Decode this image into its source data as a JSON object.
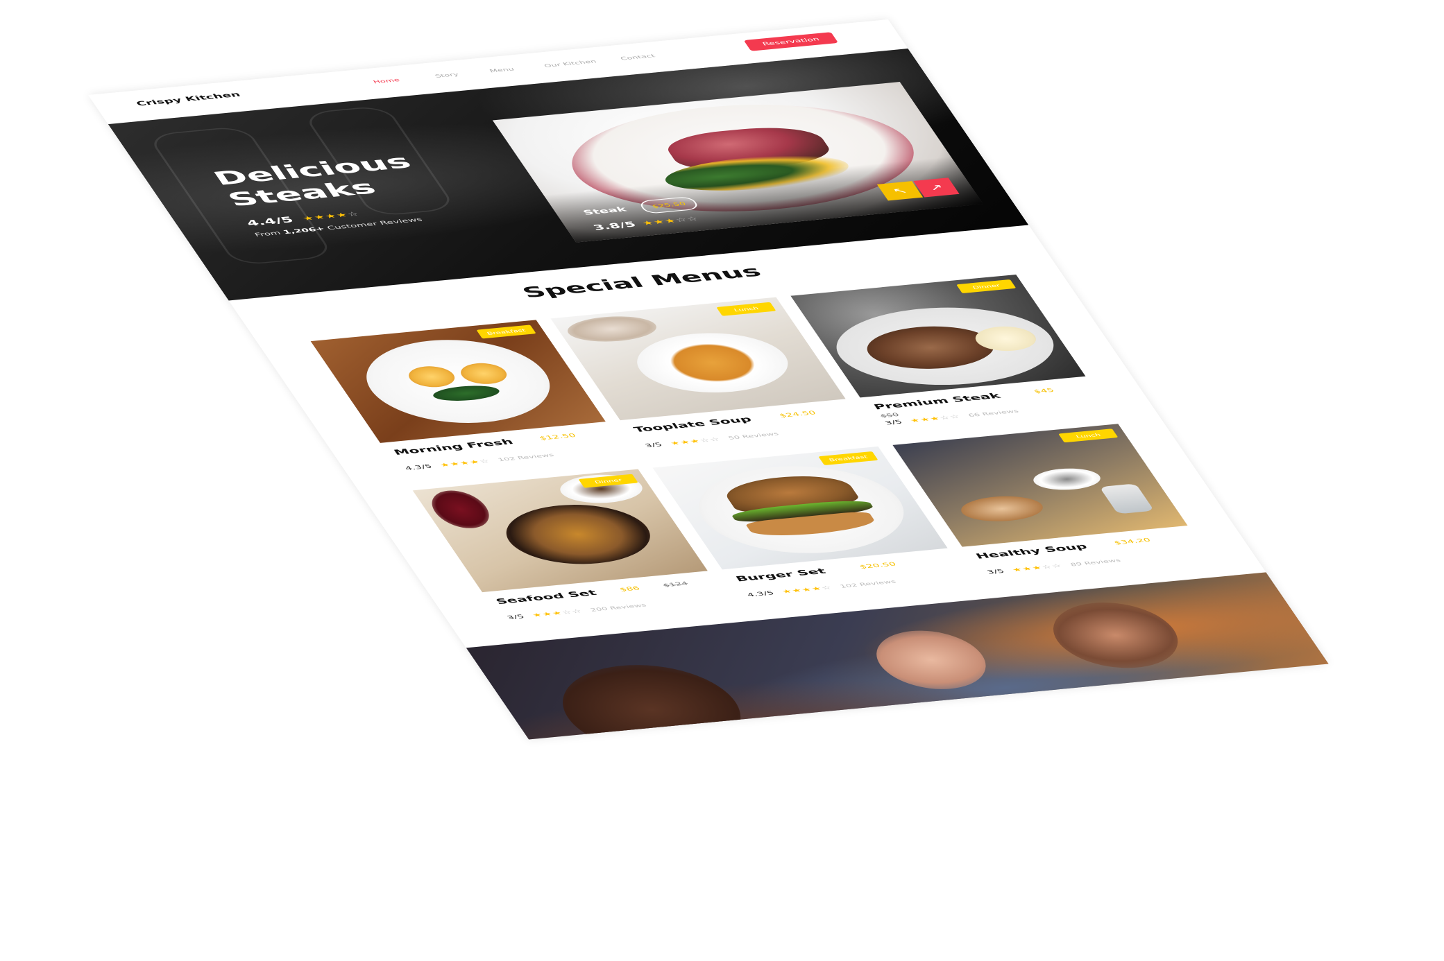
{
  "header": {
    "brand": "Crispy Kitchen",
    "nav": [
      "Home",
      "Story",
      "Menu",
      "Our Kitchen",
      "Contact"
    ],
    "reservation_label": "Reservation"
  },
  "hero": {
    "title_line1": "Delicious",
    "title_line2": "Steaks",
    "rating": "4.4/5",
    "rating_stars": 4,
    "reviews_prefix": "From ",
    "reviews_count": "1,206+",
    "reviews_suffix": " Customer Reviews",
    "feature": {
      "name": "Steak",
      "price": "$25.50",
      "rating": "3.8/5",
      "rating_stars": 3,
      "prev_icon": "arrow-left-icon",
      "next_icon": "arrow-right-icon"
    }
  },
  "special_menus": {
    "title": "Special Menus",
    "items": [
      {
        "name": "Morning Fresh",
        "price": "$12.50",
        "old_price": "",
        "rating": "4.3/5",
        "stars": 4,
        "reviews": "102 Reviews",
        "badge": "Breakfast"
      },
      {
        "name": "Tooplate Soup",
        "price": "$24.50",
        "old_price": "",
        "rating": "3/5",
        "stars": 3,
        "reviews": "50 Reviews",
        "badge": "Lunch"
      },
      {
        "name": "Premium Steak",
        "price": "$45",
        "old_price": "$50",
        "rating": "3/5",
        "stars": 3,
        "reviews": "66 Reviews",
        "badge": "Dinner"
      },
      {
        "name": "Seafood Set",
        "price": "$86",
        "old_price": "$124",
        "rating": "3/5",
        "stars": 3,
        "reviews": "200 Reviews",
        "badge": "Dinner"
      },
      {
        "name": "Burger Set",
        "price": "$20.50",
        "old_price": "",
        "rating": "4.3/5",
        "stars": 4,
        "reviews": "102 Reviews",
        "badge": "Breakfast"
      },
      {
        "name": "Healthy Soup",
        "price": "$34.20",
        "old_price": "",
        "rating": "3/5",
        "stars": 3,
        "reviews": "89 Reviews",
        "badge": "Lunch"
      }
    ]
  },
  "colors": {
    "accent": "#f43a4f",
    "star": "#ffc107",
    "badge": "#ffd600"
  }
}
